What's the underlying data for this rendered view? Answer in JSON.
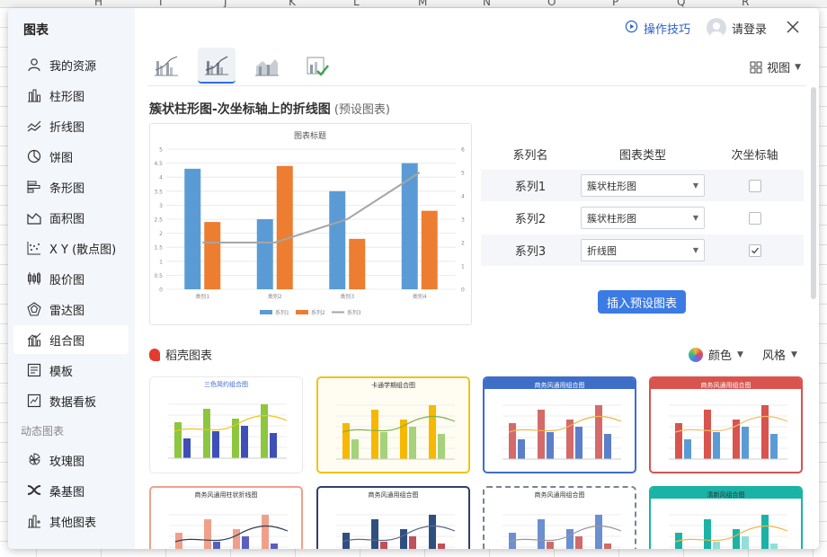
{
  "sheet": {
    "col_letters": [
      "H",
      "I",
      "J",
      "K",
      "L",
      "M",
      "N",
      "O",
      "P",
      "Q",
      "R"
    ]
  },
  "sidebar": {
    "title": "图表",
    "items": [
      {
        "label": "我的资源",
        "icon": "user-icon"
      },
      {
        "label": "柱形图",
        "icon": "column-chart-icon"
      },
      {
        "label": "折线图",
        "icon": "line-chart-icon"
      },
      {
        "label": "饼图",
        "icon": "pie-chart-icon"
      },
      {
        "label": "条形图",
        "icon": "bar-chart-icon"
      },
      {
        "label": "面积图",
        "icon": "area-chart-icon"
      },
      {
        "label": "X Y (散点图)",
        "icon": "scatter-chart-icon"
      },
      {
        "label": "股价图",
        "icon": "stock-chart-icon"
      },
      {
        "label": "雷达图",
        "icon": "radar-chart-icon"
      },
      {
        "label": "组合图",
        "icon": "combo-chart-icon",
        "active": true
      },
      {
        "label": "模板",
        "icon": "template-icon"
      },
      {
        "label": "数据看板",
        "icon": "dashboard-icon"
      }
    ],
    "group_label": "动态图表",
    "dynamic_items": [
      {
        "label": "玫瑰图",
        "icon": "rose-chart-icon"
      },
      {
        "label": "桑基图",
        "icon": "sankey-chart-icon"
      },
      {
        "label": "其他图表",
        "icon": "other-chart-icon"
      }
    ]
  },
  "header": {
    "tips_label": "操作技巧",
    "login_label": "请登录",
    "view_label": "视图"
  },
  "preset": {
    "title": "簇状柱形图-次坐标轴上的折线图",
    "subtitle": "(预设图表)",
    "insert_label": "插入预设图表"
  },
  "series_table": {
    "headers": [
      "系列名",
      "图表类型",
      "次坐标轴"
    ],
    "rows": [
      {
        "name": "系列1",
        "type": "簇状柱形图",
        "secondary": false
      },
      {
        "name": "系列2",
        "type": "簇状柱形图",
        "secondary": false
      },
      {
        "name": "系列3",
        "type": "折线图",
        "secondary": true
      }
    ]
  },
  "gallery": {
    "section_label": "稻壳图表",
    "color_label": "颜色",
    "style_label": "风格",
    "thumbs": [
      {
        "title": "三色简约组合图"
      },
      {
        "title": "卡通学期组合图"
      },
      {
        "title": "商务风通用组合图"
      },
      {
        "title": "商务风通用组合图"
      },
      {
        "title": "商务风通用柱状折线图"
      },
      {
        "title": "商务风通用组合图"
      },
      {
        "title": "商务风通用组合图"
      },
      {
        "title": "清新风组合图"
      }
    ]
  },
  "chart_data": {
    "type": "bar",
    "title": "图表标题",
    "categories": [
      "类别1",
      "类别2",
      "类别3",
      "类别4"
    ],
    "series": [
      {
        "name": "系列1",
        "type": "bar",
        "axis": "primary",
        "color": "#5b9bd5",
        "values": [
          4.3,
          2.5,
          3.5,
          4.5
        ]
      },
      {
        "name": "系列2",
        "type": "bar",
        "axis": "primary",
        "color": "#ed7d31",
        "values": [
          2.4,
          4.4,
          1.8,
          2.8
        ]
      },
      {
        "name": "系列3",
        "type": "line",
        "axis": "secondary",
        "color": "#a5a5a5",
        "values": [
          2,
          2,
          3,
          5
        ]
      }
    ],
    "ylim": [
      0,
      5
    ],
    "y_ticks": [
      "0",
      "0.5",
      "1",
      "1.5",
      "2",
      "2.5",
      "3",
      "3.5",
      "4",
      "4.5",
      "5"
    ],
    "y2lim": [
      0,
      6
    ],
    "y2_ticks": [
      "0",
      "1",
      "2",
      "3",
      "4",
      "5",
      "6"
    ],
    "grid": true,
    "legend": "bottom"
  }
}
